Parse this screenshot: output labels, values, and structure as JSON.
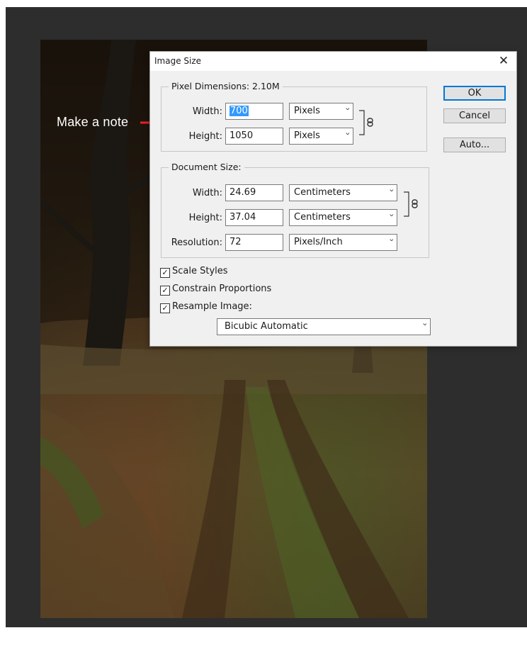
{
  "annotation": {
    "text": "Make a note"
  },
  "dialog": {
    "title": "Image Size",
    "close_glyph": "✕",
    "pixel_dimensions": {
      "legend": "Pixel Dimensions:  2.10M",
      "width_label": "Width:",
      "width_value": "700",
      "width_unit": "Pixels",
      "height_label": "Height:",
      "height_value": "1050",
      "height_unit": "Pixels"
    },
    "document_size": {
      "legend": "Document Size:",
      "width_label": "Width:",
      "width_value": "24.69",
      "width_unit": "Centimeters",
      "height_label": "Height:",
      "height_value": "37.04",
      "height_unit": "Centimeters",
      "resolution_label": "Resolution:",
      "resolution_value": "72",
      "resolution_unit": "Pixels/Inch"
    },
    "buttons": {
      "ok": "OK",
      "cancel": "Cancel",
      "auto": "Auto..."
    },
    "options": {
      "scale_styles": {
        "label": "Scale Styles",
        "checked": true
      },
      "constrain_proportions": {
        "label": "Constrain Proportions",
        "checked": true
      },
      "resample_image": {
        "label": "Resample Image:",
        "checked": true
      }
    },
    "resample_method": "Bicubic Automatic",
    "check_glyph": "✓",
    "chevron_glyph": "˅"
  },
  "colors": {
    "arrow": "#e8202a",
    "selection": "#3399ff",
    "default_button_border": "#0078d7",
    "workspace": "#2d2d2d"
  },
  "icons": [
    "close-icon",
    "chain-link-icon",
    "chevron-down-icon",
    "checkmark-icon",
    "arrow-icon"
  ]
}
